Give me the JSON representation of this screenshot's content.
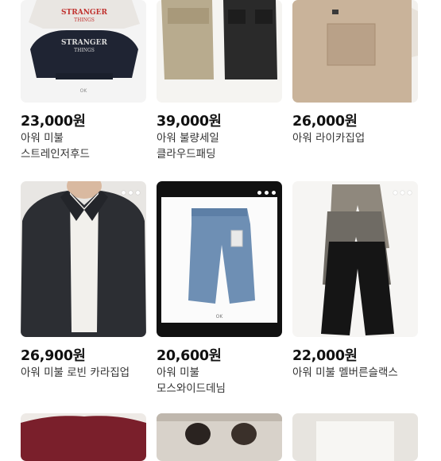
{
  "colors": {
    "background": "#ffffff",
    "price_text": "#111111",
    "title_text": "#333333"
  },
  "products": [
    {
      "price": "23,000원",
      "title_line1": "아워 미불",
      "title_line2": "스트레인저후드",
      "image_icon": "hoodie-photo",
      "print_line1": "STRANGER",
      "print_line2": "THINGS",
      "logo": "OK"
    },
    {
      "price": "39,000원",
      "title_line1": "아워 불량세일",
      "title_line2": "클라우드패딩",
      "image_icon": "padding-jacket-photo"
    },
    {
      "price": "26,000원",
      "title_line1": "아워 라이카집업",
      "title_line2": "",
      "image_icon": "zip-up-jacket-photo"
    },
    {
      "price": "26,900원",
      "title_line1": "아워 미불 로빈 카라집업",
      "title_line2": "",
      "image_icon": "collar-jacket-photo"
    },
    {
      "price": "20,600원",
      "title_line1": "아워 미불",
      "title_line2": "모스와이드데님",
      "image_icon": "denim-pants-photo",
      "logo": "OK"
    },
    {
      "price": "22,000원",
      "title_line1": "아워 미불 멜버른슬랙스",
      "title_line2": "",
      "image_icon": "slacks-photo"
    },
    {
      "image_icon": "red-jacket-photo"
    },
    {
      "image_icon": "people-photo"
    },
    {
      "image_icon": "white-item-photo"
    }
  ]
}
